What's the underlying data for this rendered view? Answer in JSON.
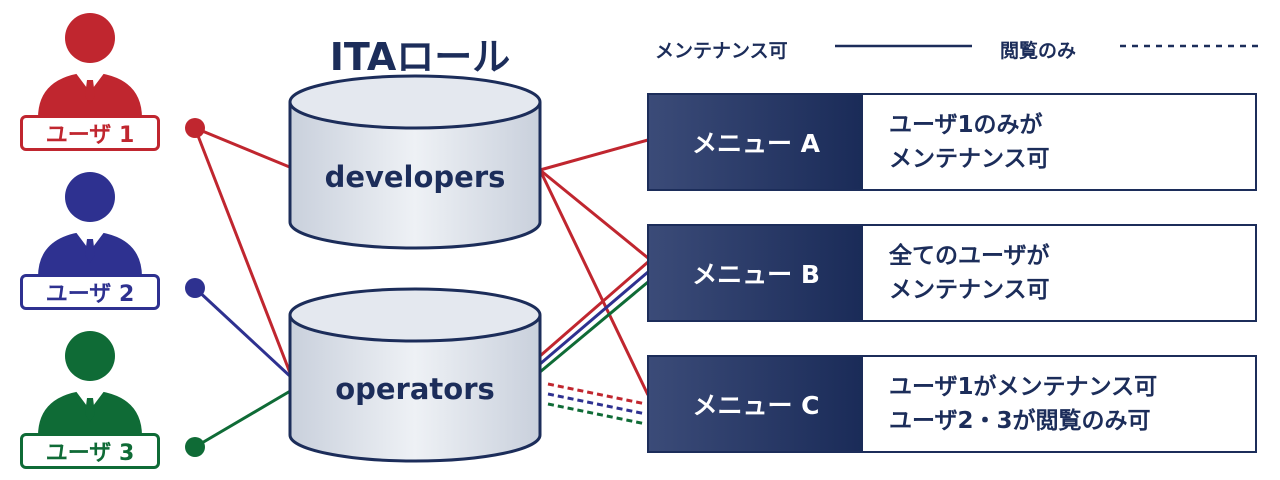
{
  "title": "ITAロール",
  "legend": {
    "maintain_label": "メンテナンス可",
    "view_label": "閲覧のみ"
  },
  "colors": {
    "user1": "#c0262f",
    "user2": "#2e3190",
    "user3": "#0f6b36",
    "navy": "#1c2d5a"
  },
  "users": [
    {
      "label": "ユーザ 1"
    },
    {
      "label": "ユーザ 2"
    },
    {
      "label": "ユーザ 3"
    }
  ],
  "roles": [
    {
      "label": "developers"
    },
    {
      "label": "operators"
    }
  ],
  "menus": [
    {
      "name": "メニュー A",
      "desc": [
        "ユーザ1のみが",
        "メンテナンス可"
      ]
    },
    {
      "name": "メニュー B",
      "desc": [
        "全てのユーザが",
        "メンテナンス可"
      ]
    },
    {
      "name": "メニュー C",
      "desc": [
        "ユーザ1がメンテナンス可",
        "ユーザ2・3が閲覧のみ可"
      ]
    }
  ]
}
